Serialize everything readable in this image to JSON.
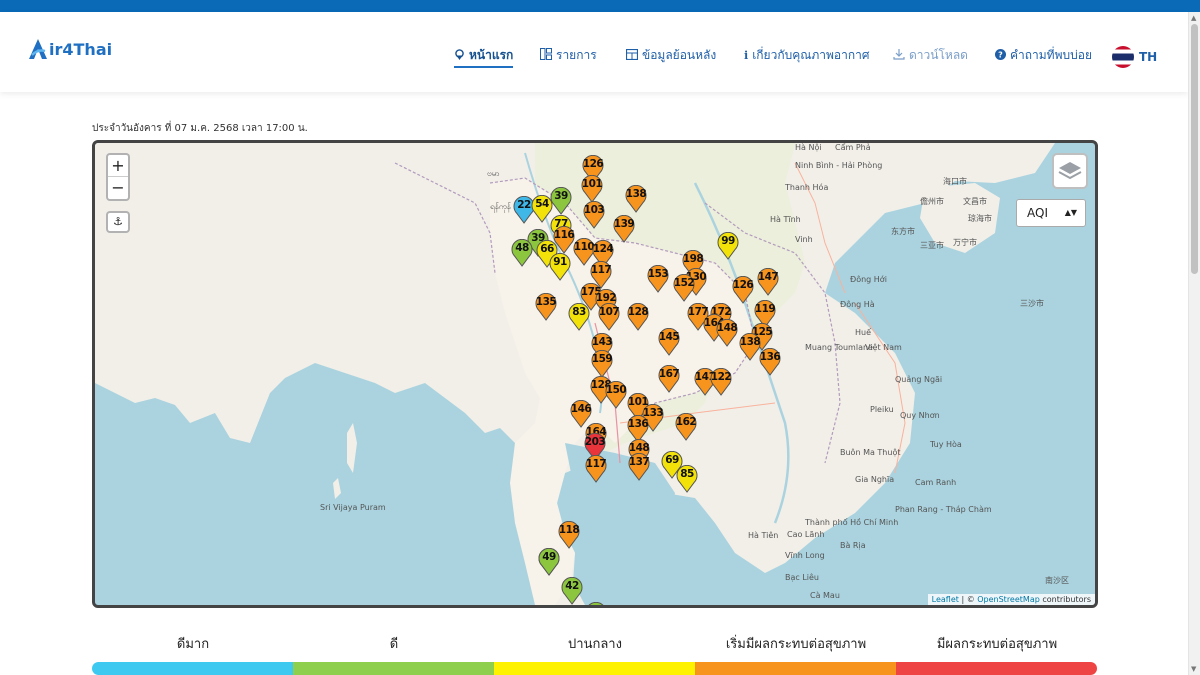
{
  "app": {
    "name": "ir4Thai"
  },
  "nav": [
    {
      "label": "หน้าแรก",
      "icon": "map-pin-icon"
    },
    {
      "label": "รายการ",
      "icon": "grid-icon"
    },
    {
      "label": "ข้อมูลย้อนหลัง",
      "icon": "table-icon"
    },
    {
      "label": "เกี่ยวกับคุณภาพอากาศ",
      "icon": "info-icon"
    },
    {
      "label": "ดาวน์โหลด",
      "icon": "download-icon"
    },
    {
      "label": "คำถามที่พบบ่อย",
      "icon": "question-icon"
    }
  ],
  "language": "TH",
  "date_text": "ประจำวันอังคาร ที่ 07 ม.ค. 2568 เวลา 17:00 น.",
  "map": {
    "zoom_in": "+",
    "zoom_out": "−",
    "select_value": "AQI",
    "attribution_leaflet": "Leaflet",
    "attribution_sep": " | © ",
    "attribution_osm": "OpenStreetMap",
    "attribution_tail": " contributors",
    "labels": [
      "Hà Nội",
      "Cẩm Phả",
      "Ninh Bình - Hải Phòng",
      "Thanh Hóa",
      "Vinh",
      "Hà Tĩnh",
      "Đông Hới",
      "Đông Hà",
      "Huế",
      "Muang Toumlane",
      "Việt Nam",
      "Quảng Ngãi",
      "Pleiku",
      "Quy Nhơn",
      "Tuy Hòa",
      "Buôn Ma Thuột",
      "Gia Nghĩa",
      "Cam Ranh",
      "Phan Rang - Tháp Chàm",
      "Thành phố Hồ Chí Minh",
      "Cao Lãnh",
      "Bà Rịa",
      "Hà Tiên",
      "Vĩnh Long",
      "Bạc Liêu",
      "Sri Vijaya Puram",
      "海口市",
      "儋州市",
      "文昌市",
      "东方市",
      "琼海市",
      "三亚市",
      "万宁市",
      "三沙市",
      "南沙区",
      "ရန်ကုန်",
      "ဗမာ",
      "Cà Mau"
    ],
    "markers": [
      {
        "aqi": "126",
        "color": "#f7941d"
      },
      {
        "aqi": "101",
        "color": "#f7941d"
      },
      {
        "aqi": "138",
        "color": "#f7941d"
      },
      {
        "aqi": "39",
        "color": "#8cc63f"
      },
      {
        "aqi": "22",
        "color": "#3fb8e8"
      },
      {
        "aqi": "54",
        "color": "#f2e20a"
      },
      {
        "aqi": "103",
        "color": "#f7941d"
      },
      {
        "aqi": "139",
        "color": "#f7941d"
      },
      {
        "aqi": "77",
        "color": "#f2e20a"
      },
      {
        "aqi": "39",
        "color": "#8cc63f"
      },
      {
        "aqi": "116",
        "color": "#f7941d"
      },
      {
        "aqi": "48",
        "color": "#8cc63f"
      },
      {
        "aqi": "66",
        "color": "#f2e20a"
      },
      {
        "aqi": "110",
        "color": "#f7941d"
      },
      {
        "aqi": "124",
        "color": "#f7941d"
      },
      {
        "aqi": "91",
        "color": "#f2e20a"
      },
      {
        "aqi": "99",
        "color": "#f2e20a"
      },
      {
        "aqi": "198",
        "color": "#f7941d"
      },
      {
        "aqi": "117",
        "color": "#f7941d"
      },
      {
        "aqi": "153",
        "color": "#f7941d"
      },
      {
        "aqi": "130",
        "color": "#f7941d"
      },
      {
        "aqi": "152",
        "color": "#f7941d"
      },
      {
        "aqi": "147",
        "color": "#f7941d"
      },
      {
        "aqi": "126",
        "color": "#f7941d"
      },
      {
        "aqi": "175",
        "color": "#f7941d"
      },
      {
        "aqi": "192",
        "color": "#f7941d"
      },
      {
        "aqi": "135",
        "color": "#f7941d"
      },
      {
        "aqi": "83",
        "color": "#f2e20a"
      },
      {
        "aqi": "107",
        "color": "#f7941d"
      },
      {
        "aqi": "128",
        "color": "#f7941d"
      },
      {
        "aqi": "177",
        "color": "#f7941d"
      },
      {
        "aqi": "172",
        "color": "#f7941d"
      },
      {
        "aqi": "119",
        "color": "#f7941d"
      },
      {
        "aqi": "164",
        "color": "#f7941d"
      },
      {
        "aqi": "148",
        "color": "#f7941d"
      },
      {
        "aqi": "125",
        "color": "#f7941d"
      },
      {
        "aqi": "145",
        "color": "#f7941d"
      },
      {
        "aqi": "138",
        "color": "#f7941d"
      },
      {
        "aqi": "143",
        "color": "#f7941d"
      },
      {
        "aqi": "159",
        "color": "#f7941d"
      },
      {
        "aqi": "136",
        "color": "#f7941d"
      },
      {
        "aqi": "167",
        "color": "#f7941d"
      },
      {
        "aqi": "141",
        "color": "#f7941d"
      },
      {
        "aqi": "122",
        "color": "#f7941d"
      },
      {
        "aqi": "128",
        "color": "#f7941d"
      },
      {
        "aqi": "150",
        "color": "#f7941d"
      },
      {
        "aqi": "101",
        "color": "#f7941d"
      },
      {
        "aqi": "146",
        "color": "#f7941d"
      },
      {
        "aqi": "133",
        "color": "#f7941d"
      },
      {
        "aqi": "162",
        "color": "#f7941d"
      },
      {
        "aqi": "136",
        "color": "#f7941d"
      },
      {
        "aqi": "164",
        "color": "#f7941d"
      },
      {
        "aqi": "203",
        "color": "#e8343a"
      },
      {
        "aqi": "49",
        "color": "#8cc63f"
      },
      {
        "aqi": "148",
        "color": "#f7941d"
      },
      {
        "aqi": "137",
        "color": "#f7941d"
      },
      {
        "aqi": "69",
        "color": "#f2e20a"
      },
      {
        "aqi": "85",
        "color": "#f2e20a"
      },
      {
        "aqi": "117",
        "color": "#f7941d"
      },
      {
        "aqi": "118",
        "color": "#f7941d"
      },
      {
        "aqi": "49",
        "color": "#8cc63f"
      },
      {
        "aqi": "42",
        "color": "#8cc63f"
      },
      {
        "aqi": "43",
        "color": "#8cc63f"
      }
    ]
  },
  "legend": [
    {
      "label": "ดีมาก",
      "color": "#3ec9f0"
    },
    {
      "label": "ดี",
      "color": "#8ed04d"
    },
    {
      "label": "ปานกลาง",
      "color": "#fff200"
    },
    {
      "label": "เริ่มมีผลกระทบต่อสุขภาพ",
      "color": "#f7941d"
    },
    {
      "label": "มีผลกระทบต่อสุขภาพ",
      "color": "#ef4444"
    }
  ]
}
